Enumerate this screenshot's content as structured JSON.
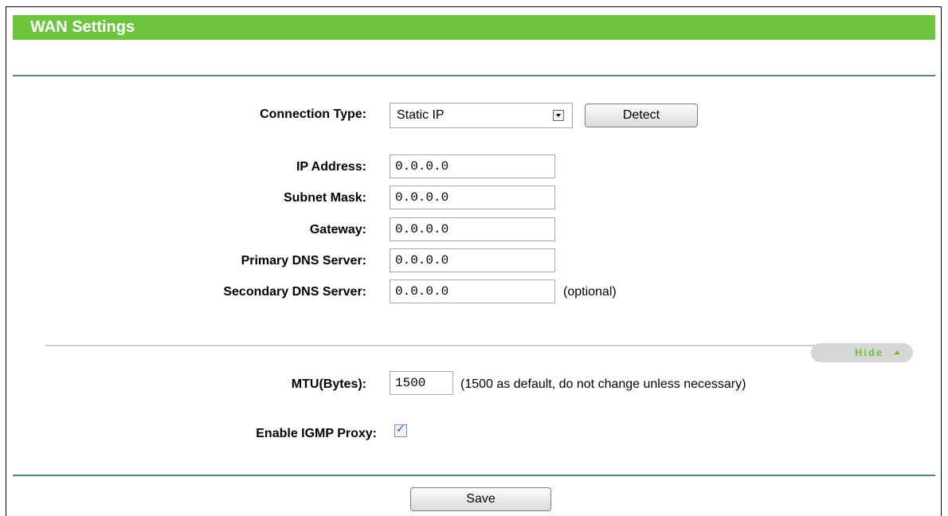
{
  "header": {
    "title": "WAN Settings"
  },
  "connection": {
    "label": "Connection Type:",
    "selected": "Static IP",
    "detect_label": "Detect"
  },
  "fields": {
    "ip_address": {
      "label": "IP Address:",
      "value": "0.0.0.0"
    },
    "subnet_mask": {
      "label": "Subnet Mask:",
      "value": "0.0.0.0"
    },
    "gateway": {
      "label": "Gateway:",
      "value": "0.0.0.0"
    },
    "primary_dns": {
      "label": "Primary DNS Server:",
      "value": "0.0.0.0"
    },
    "secondary_dns": {
      "label": "Secondary DNS Server:",
      "value": "0.0.0.0",
      "note": "(optional)"
    }
  },
  "advanced": {
    "toggle_label": "Hide",
    "mtu": {
      "label": "MTU(Bytes):",
      "value": "1500",
      "note": "(1500 as default, do not change unless necessary)"
    },
    "igmp": {
      "label": "Enable IGMP Proxy:",
      "checked": true
    }
  },
  "footer": {
    "save_label": "Save"
  },
  "colors": {
    "title_bar": "#6ec43c",
    "divider": "#4f8c6a",
    "hide_text": "#6fbf3c"
  }
}
